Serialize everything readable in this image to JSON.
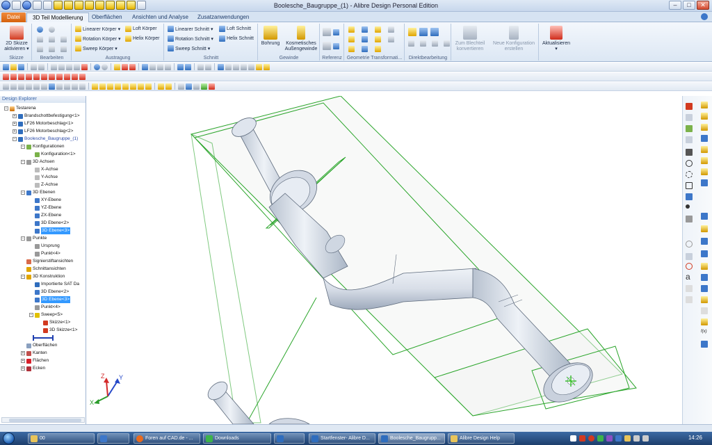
{
  "window": {
    "title": "Boolesche_Baugruppe_(1) - Alibre Design Personal Edition",
    "min": "–",
    "max": "□",
    "close": "✕"
  },
  "tabs": [
    {
      "label": "Datei"
    },
    {
      "label": "3D Teil Modellierung"
    },
    {
      "label": "Oberflächen"
    },
    {
      "label": "Ansichten und Analyse"
    },
    {
      "label": "Zusatzanwendungen"
    }
  ],
  "ribbon": {
    "skizze": {
      "button_line1": "2D Skizze",
      "button_line2": "aktivieren ▾",
      "label": "Skizze"
    },
    "bearbeiten": {
      "label": "Bearbeiten"
    },
    "austragung": {
      "items": [
        "Linearer Körper ▾",
        "Rotation Körper ▾",
        "Sweep Körper ▾",
        "Loft Körper",
        "Helix Körper"
      ],
      "label": "Austragung"
    },
    "schnitt": {
      "items": [
        "Linearer Schnitt ▾",
        "Rotation Schnitt ▾",
        "Sweep Schnitt ▾",
        "Loft Schnitt",
        "Helix Schnitt"
      ],
      "label": "Schnitt"
    },
    "gewinde": {
      "bohrung": "Bohrung",
      "kosmetisch_line1": "Kosmetisches",
      "kosmetisch_line2": "Außengewinde",
      "label": "Gewinde"
    },
    "referenz": {
      "label": "Referenz"
    },
    "geometrie": {
      "label": "Geometrie Transformati..."
    },
    "direkt": {
      "label": "Direktbearbeitung"
    },
    "blechteil": {
      "line1": "Zum Blechteil",
      "line2": "konvertieren"
    },
    "konfiguration": {
      "line1": "Neue Konfiguration",
      "line2": "erstellen"
    },
    "aktualisieren": {
      "label": "Aktualisieren",
      "arrow": "▾"
    }
  },
  "explorer": {
    "title": "Design Explorer",
    "nodes": [
      {
        "label": "Testarena"
      },
      {
        "label": "Brandschottbefestigung<1>"
      },
      {
        "label": "LF26 Motorbeschlag<1>"
      },
      {
        "label": "LF26 Motorbeschlag<2>"
      },
      {
        "label": "Boolesche_Baugruppe_(1)"
      },
      {
        "label": "Konfigurationen"
      },
      {
        "label": "Konfiguration<1>"
      },
      {
        "label": "3D Achsen"
      },
      {
        "label": "X-Achse"
      },
      {
        "label": "Y-Achse"
      },
      {
        "label": "Z-Achse"
      },
      {
        "label": "3D Ebenen"
      },
      {
        "label": "XY-Ebene"
      },
      {
        "label": "YZ-Ebene"
      },
      {
        "label": "ZX-Ebene"
      },
      {
        "label": "3D Ebene<2>"
      },
      {
        "label": "3D Ebene<3>"
      },
      {
        "label": "Punkte"
      },
      {
        "label": "Ursprung"
      },
      {
        "label": "Punkt<4>"
      },
      {
        "label": "Signierstiftansichten"
      },
      {
        "label": "Schnittansichten"
      },
      {
        "label": "3D Konstruktion"
      },
      {
        "label": "Importierte SAT Da"
      },
      {
        "label": "3D Ebene<2>"
      },
      {
        "label": "3D Ebene<3>"
      },
      {
        "label": "Punkt<4>"
      },
      {
        "label": "Sweep<5>"
      },
      {
        "label": "Skizze<1>"
      },
      {
        "label": "3D Skizze<1>"
      },
      {
        "label": "Oberflächen"
      },
      {
        "label": "Kanten"
      },
      {
        "label": "Flächen"
      },
      {
        "label": "Ecken"
      }
    ]
  },
  "axes": {
    "x": "X",
    "y": "Y",
    "z": "Z"
  },
  "right_toolbar": {
    "text_a": "a",
    "fx": "f(x)"
  },
  "taskbar": {
    "items": [
      {
        "label": "00"
      },
      {
        "label": "Foren auf CAD.de - ..."
      },
      {
        "label": "Downloads"
      },
      {
        "label": "Startfenster- Alibre D..."
      },
      {
        "label": "Boolesche_Baugrupp..."
      },
      {
        "label": "Alibre Design Help"
      }
    ],
    "clock": "14:26"
  }
}
